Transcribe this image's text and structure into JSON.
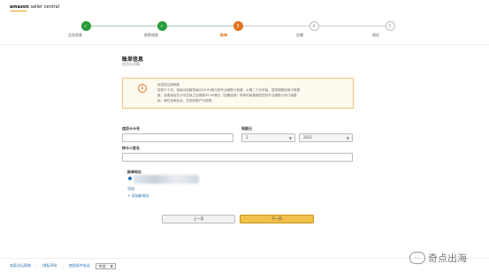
{
  "header": {
    "logo_text": "amazon",
    "logo_sub": "seller central"
  },
  "steps": [
    {
      "label": "企业信息",
      "state": "done",
      "marker": "✓"
    },
    {
      "label": "卖家信息",
      "state": "done",
      "marker": "✓"
    },
    {
      "label": "账单",
      "state": "active",
      "marker": "3"
    },
    {
      "label": "店铺",
      "state": "todo",
      "marker": "4"
    },
    {
      "label": "验证",
      "state": "todo",
      "marker": "5"
    }
  ],
  "page": {
    "title": "账单信息",
    "subtitle": "信用卡详情"
  },
  "alert": {
    "icon": "$",
    "lines": [
      "欢迎您注册销售",
      "您的下个月，将每月收取您每月39.99美元的专业销售计划费。从第二个月开始，您将按照信用卡收费",
      "费，该费用会在计划生效之后按照39.99美元（如果适用）时间扣除费用的您的专业销售计划订阅费",
      "用，请在卖家后台，在您的账户中查看。"
    ]
  },
  "form": {
    "card_label": "信用卡卡号",
    "expiry_label": "到期日",
    "expiry_month": "1",
    "expiry_year": "2021",
    "holder_label": "持卡人姓名"
  },
  "address": {
    "title": "账单地址",
    "edit_link": "添加",
    "add_link": "+ 添加新地址"
  },
  "buttons": {
    "prev": "上一页",
    "next": "下一页"
  },
  "footer": {
    "links": [
      "卖家论坛帮助",
      "隐私声明",
      "使用条件协议"
    ],
    "language": "中文"
  },
  "watermark": {
    "text": "奇点出海"
  },
  "colors": {
    "done": "#2a9d3a",
    "active": "#e2711d",
    "button_primary": "#f0c14b",
    "link": "#1f6fb2"
  }
}
